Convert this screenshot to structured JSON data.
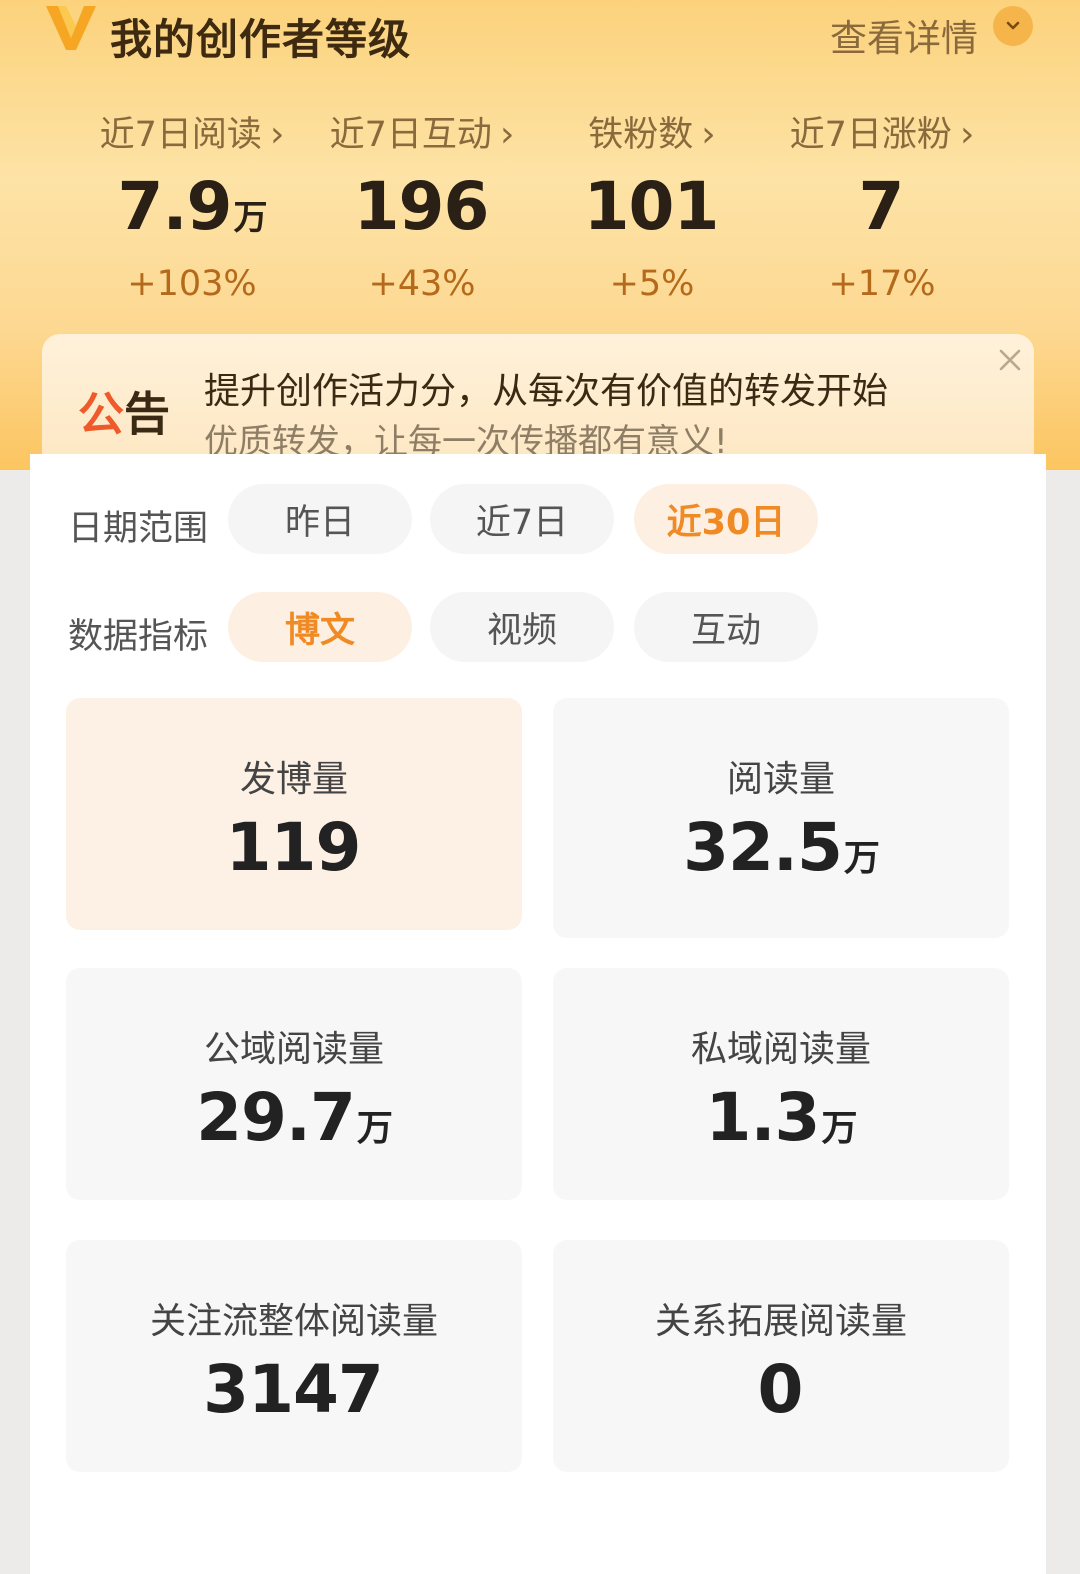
{
  "header": {
    "title": "我的创作者等级",
    "detail_label": "查看详情",
    "stats": [
      {
        "label": "近7日阅读",
        "value": "7.9",
        "unit": "万",
        "change": "+103%"
      },
      {
        "label": "近7日互动",
        "value": "196",
        "unit": "",
        "change": "+43%"
      },
      {
        "label": "铁粉数",
        "value": "101",
        "unit": "",
        "change": "+5%"
      },
      {
        "label": "近7日涨粉",
        "value": "7",
        "unit": "",
        "change": "+17%"
      }
    ]
  },
  "notice": {
    "tag_a": "公",
    "tag_b": "告",
    "main": "提升创作活力分，从每次有价值的转发开始",
    "sub": "优质转发，让每一次传播都有意义!"
  },
  "filters": {
    "date_label": "日期范围",
    "date_options": [
      "昨日",
      "近7日",
      "近30日"
    ],
    "metric_label": "数据指标",
    "metric_options": [
      "博文",
      "视频",
      "互动"
    ]
  },
  "cards": [
    {
      "label": "发博量",
      "value": "119",
      "unit": ""
    },
    {
      "label": "阅读量",
      "value": "32.5",
      "unit": "万"
    },
    {
      "label": "公域阅读量",
      "value": "29.7",
      "unit": "万"
    },
    {
      "label": "私域阅读量",
      "value": "1.3",
      "unit": "万"
    },
    {
      "label": "关注流整体阅读量",
      "value": "3147",
      "unit": ""
    },
    {
      "label": "关系拓展阅读量",
      "value": "0",
      "unit": ""
    }
  ],
  "colors": {
    "accent": "#f08a24",
    "header_top": "#fcd27c",
    "change_text": "#b46a1a",
    "notice_tag": "#ee5a2b"
  },
  "icons": [
    "v-level-logo-icon",
    "chevron-down-icon",
    "chevron-right-icon",
    "close-icon"
  ]
}
